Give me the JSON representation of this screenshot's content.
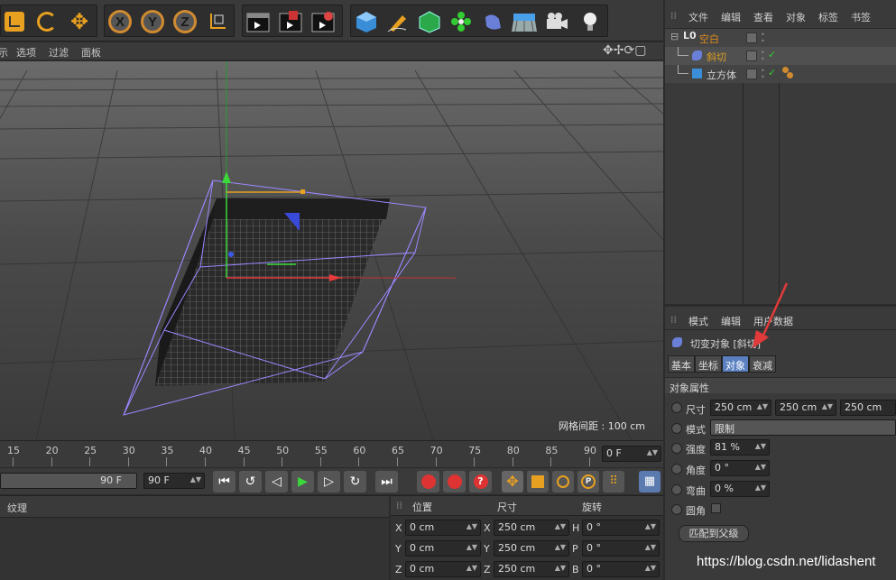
{
  "objmgr": {
    "menu": [
      "文件",
      "编辑",
      "查看",
      "对象",
      "标签",
      "书签"
    ],
    "objects": [
      {
        "name": "空白",
        "color": "#e08a20"
      },
      {
        "name": "斜切",
        "color": "#e0a020"
      },
      {
        "name": "立方体",
        "color": "#d0d0d0"
      }
    ]
  },
  "attr": {
    "menu": [
      "模式",
      "编辑",
      "用户数据"
    ],
    "title": "切变对象 [斜切]",
    "tabs": [
      "基本",
      "坐标",
      "对象",
      "衰减"
    ],
    "section": "对象属性",
    "size_label": "尺寸",
    "size": [
      "250 cm",
      "250 cm",
      "250 cm"
    ],
    "mode_label": "模式",
    "mode": "限制",
    "strength_label": "强度",
    "strength": "81 %",
    "angle_label": "角度",
    "angle": "0 °",
    "bend_label": "弯曲",
    "bend": "0 %",
    "fillet_label": "圆角",
    "match_button": "匹配到父级"
  },
  "viewport": {
    "menu": [
      "示",
      "选项",
      "过滤",
      "面板"
    ],
    "grid_label": "网格间距 : 100 cm"
  },
  "timeline": {
    "ticks": [
      "15",
      "20",
      "25",
      "30",
      "35",
      "40",
      "45",
      "50",
      "55",
      "60",
      "65",
      "70",
      "75",
      "80",
      "85",
      "90"
    ],
    "current": "0 F",
    "end_a": "90 F",
    "end_b": "90 F"
  },
  "material": {
    "label": "纹理"
  },
  "coords": {
    "headers": [
      "位置",
      "尺寸",
      "旋转"
    ],
    "rows": [
      {
        "a": "X",
        "pos": "0 cm",
        "b": "X",
        "size": "250 cm",
        "c": "H",
        "rot": "0 °"
      },
      {
        "a": "Y",
        "pos": "0 cm",
        "b": "Y",
        "size": "250 cm",
        "c": "P",
        "rot": "0 °"
      },
      {
        "a": "Z",
        "pos": "0 cm",
        "b": "Z",
        "size": "250 cm",
        "c": "B",
        "rot": "0 °"
      }
    ]
  },
  "watermark": "https://blog.csdn.net/lidashent",
  "toolbar": {
    "x": "X",
    "y": "Y",
    "z": "Z"
  }
}
